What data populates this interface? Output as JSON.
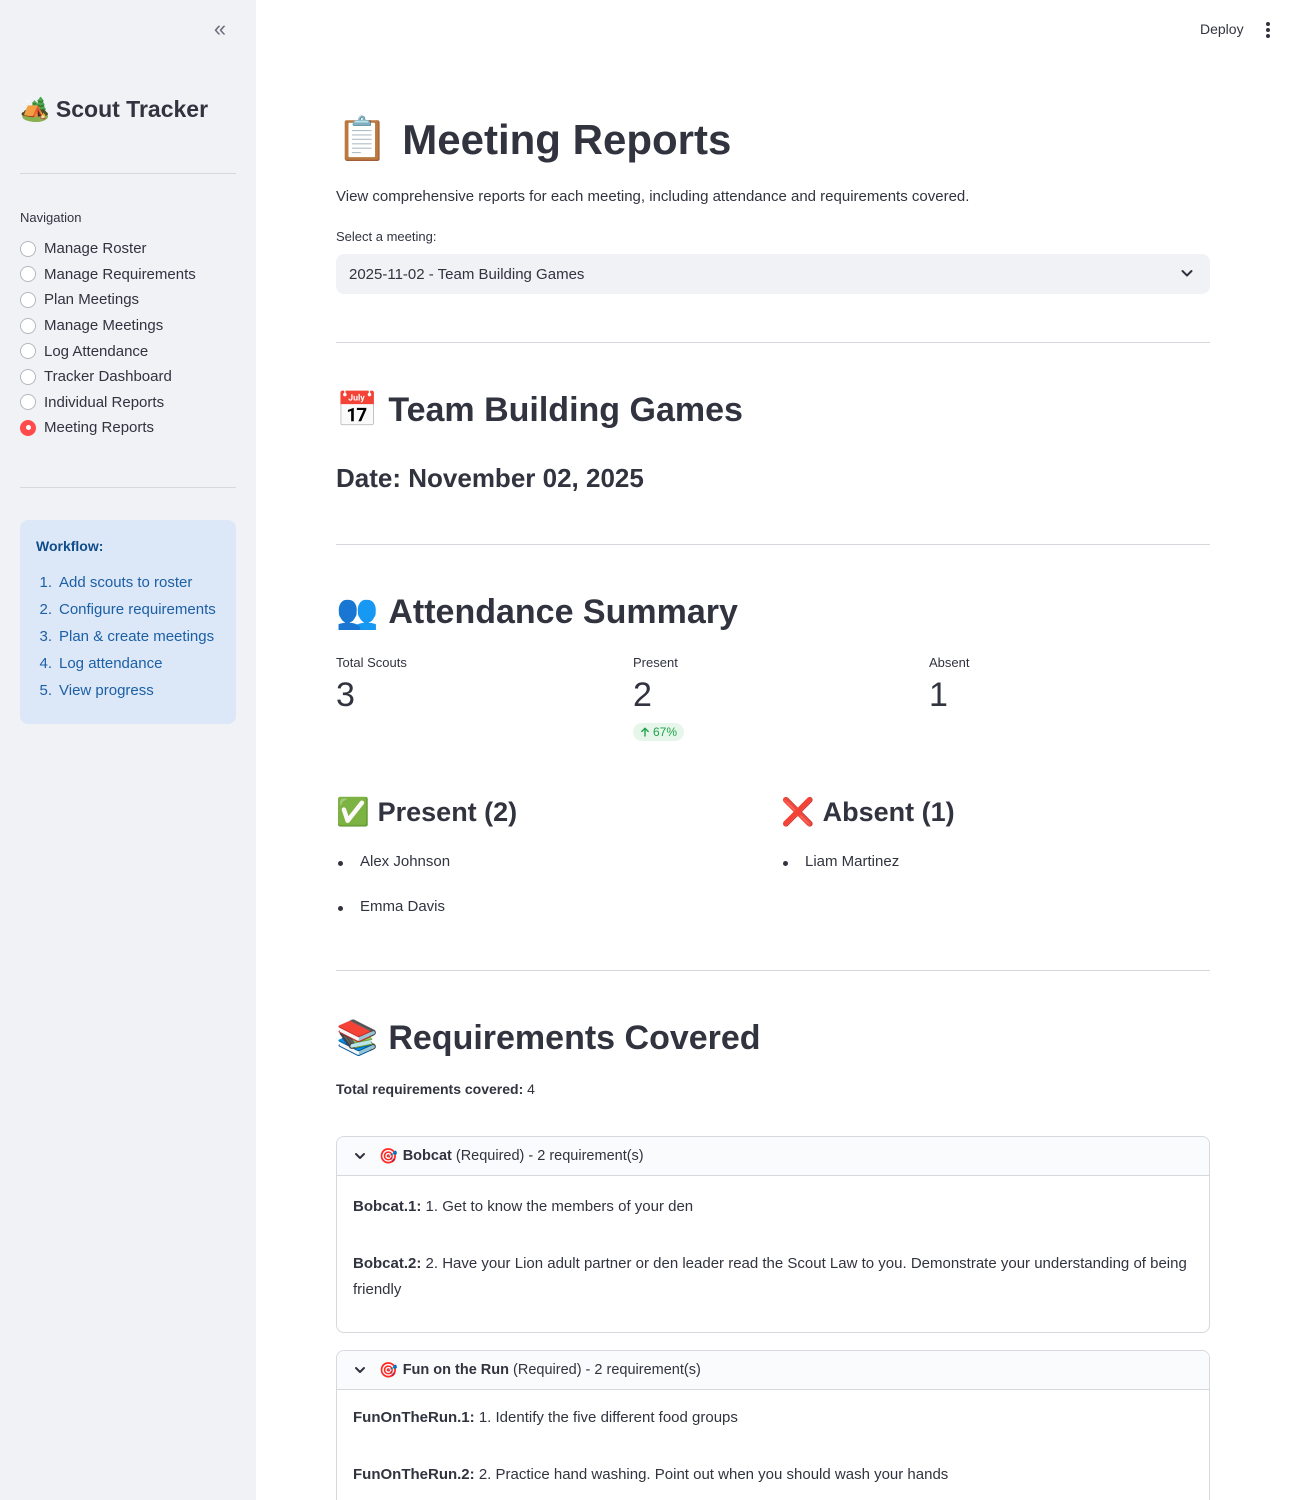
{
  "sidebar": {
    "app_title": "Scout Tracker",
    "nav_label": "Navigation",
    "nav_items": [
      {
        "label": "Manage Roster",
        "selected": false
      },
      {
        "label": "Manage Requirements",
        "selected": false
      },
      {
        "label": "Plan Meetings",
        "selected": false
      },
      {
        "label": "Manage Meetings",
        "selected": false
      },
      {
        "label": "Log Attendance",
        "selected": false
      },
      {
        "label": "Tracker Dashboard",
        "selected": false
      },
      {
        "label": "Individual Reports",
        "selected": false
      },
      {
        "label": "Meeting Reports",
        "selected": true
      }
    ],
    "workflow": {
      "title": "Workflow:",
      "steps": [
        {
          "num": "1.",
          "label": "Add scouts to roster"
        },
        {
          "num": "2.",
          "label": "Configure requirements"
        },
        {
          "num": "3.",
          "label": "Plan & create meetings"
        },
        {
          "num": "4.",
          "label": "Log attendance"
        },
        {
          "num": "5.",
          "label": "View progress"
        }
      ]
    }
  },
  "topbar": {
    "deploy_label": "Deploy"
  },
  "page": {
    "title": "Meeting Reports",
    "subtitle": "View comprehensive reports for each meeting, including attendance and requirements covered.",
    "select_label": "Select a meeting:",
    "selected_meeting": "2025-11-02 - Team Building Games"
  },
  "meeting": {
    "name": "Team Building Games",
    "date_text": "Date: November 02, 2025"
  },
  "attendance": {
    "title": "Attendance Summary",
    "metrics": [
      {
        "label": "Total Scouts",
        "value": "3",
        "delta": ""
      },
      {
        "label": "Present",
        "value": "2",
        "delta": "67%"
      },
      {
        "label": "Absent",
        "value": "1",
        "delta": ""
      }
    ],
    "present_heading": "Present (2)",
    "absent_heading": "Absent (1)",
    "present_list": [
      "Alex Johnson",
      "Emma Davis"
    ],
    "absent_list": [
      "Liam Martinez"
    ]
  },
  "requirements": {
    "title": "Requirements Covered",
    "total_label": "Total requirements covered:",
    "total_value": "4",
    "groups": [
      {
        "name": "Bobcat",
        "suffix": "(Required) - 2 requirement(s)",
        "items": [
          {
            "code": "Bobcat.1:",
            "text": "1. Get to know the members of your den"
          },
          {
            "code": "Bobcat.2:",
            "text": "2. Have your Lion adult partner or den leader read the Scout Law to you. Demonstrate your understanding of being friendly"
          }
        ]
      },
      {
        "name": "Fun on the Run",
        "suffix": "(Required) - 2 requirement(s)",
        "items": [
          {
            "code": "FunOnTheRun.1:",
            "text": "1. Identify the five different food groups"
          },
          {
            "code": "FunOnTheRun.2:",
            "text": "2. Practice hand washing. Point out when you should wash your hands"
          }
        ]
      }
    ]
  },
  "colors": {
    "sidebar_bg": "#f0f2f6",
    "accent_red": "#ff4b4b",
    "info_bg": "#dce8f7",
    "info_text": "#1c5fa5",
    "delta_green": "#21a34c"
  },
  "icons": {
    "app": "camping-tent-icon",
    "title": "clipboard-icon",
    "meeting": "calendar-icon",
    "attendance": "people-icon",
    "present": "check-mark-icon",
    "absent": "cross-mark-icon",
    "requirements": "books-icon",
    "group": "target-icon"
  }
}
